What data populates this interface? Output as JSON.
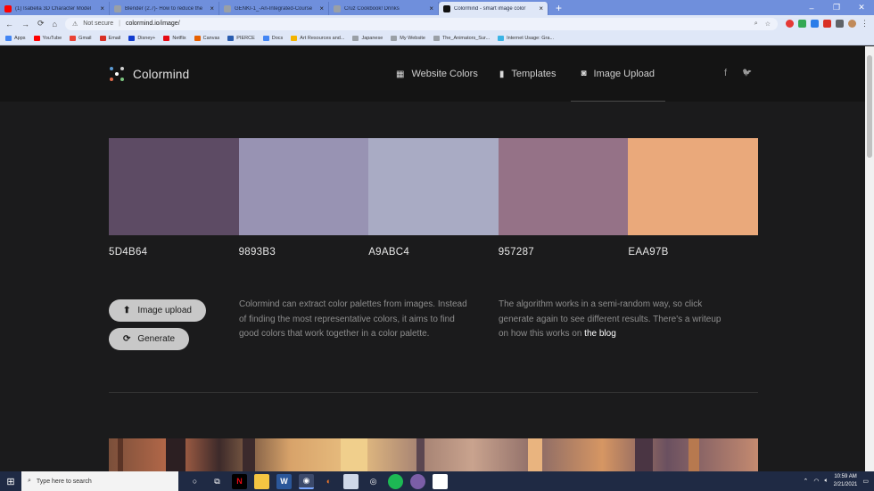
{
  "browser": {
    "tabs": [
      {
        "title": "(1) Isabella 3D Character Model",
        "favicon_color": "#ff0000",
        "active": false
      },
      {
        "title": "Blender (2.7)- How to reduce the",
        "favicon_color": "#9aa0a6",
        "active": false
      },
      {
        "title": "GENKI-1_-An-Integrated-Course",
        "favicon_color": "#9aa0a6",
        "active": false
      },
      {
        "title": "Cruz Cookbook! Drinks",
        "favicon_color": "#9aa0a6",
        "active": false
      },
      {
        "title": "Colormind - smart image color",
        "favicon_color": "#111111",
        "active": true
      }
    ],
    "new_tab": "+",
    "window_controls": [
      "–",
      "❐",
      "✕"
    ],
    "security_label": "Not secure",
    "url": "colormind.io/image/",
    "bookmarks": [
      {
        "label": "Apps",
        "color": "#4285f4"
      },
      {
        "label": "YouTube",
        "color": "#ff0000"
      },
      {
        "label": "Gmail",
        "color": "#ea4335"
      },
      {
        "label": "Email",
        "color": "#d93025"
      },
      {
        "label": "Disney+",
        "color": "#113ccf"
      },
      {
        "label": "Netflix",
        "color": "#e50914"
      },
      {
        "label": "Canvas",
        "color": "#e66000"
      },
      {
        "label": "PIERCE",
        "color": "#2a5db0"
      },
      {
        "label": "Docs",
        "color": "#4285f4"
      },
      {
        "label": "Art Resources and...",
        "color": "#f4b400"
      },
      {
        "label": "Japanese",
        "color": "#9aa0a6"
      },
      {
        "label": "My Website",
        "color": "#9aa0a6"
      },
      {
        "label": "The_Animators_Sur...",
        "color": "#9aa0a6"
      },
      {
        "label": "Internet Usage: Gra...",
        "color": "#3bb4e5"
      }
    ]
  },
  "site": {
    "brand": "Colormind",
    "nav": [
      {
        "label": "Website Colors",
        "icon": "grid-icon",
        "active": false
      },
      {
        "label": "Templates",
        "icon": "bookmark-icon",
        "active": false
      },
      {
        "label": "Image Upload",
        "icon": "camera-icon",
        "active": true
      }
    ],
    "social": [
      "f",
      "🐦"
    ],
    "palette": [
      {
        "hex": "5D4B64",
        "color": "#5D4B64"
      },
      {
        "hex": "9893B3",
        "color": "#9893B3"
      },
      {
        "hex": "A9ABC4",
        "color": "#A9ABC4"
      },
      {
        "hex": "957287",
        "color": "#957287"
      },
      {
        "hex": "EAA97B",
        "color": "#EAA97B"
      }
    ],
    "buttons": {
      "upload": "Image upload",
      "generate": "Generate"
    },
    "description_1": "Colormind can extract color palettes from images. Instead of finding the most representative colors, it aims to find good colors that work together in a color palette.",
    "description_2_prefix": "The algorithm works in a semi-random way, so click generate again to see different results. There's a writeup on how this works on ",
    "description_2_link": "the blog"
  },
  "taskbar": {
    "search_placeholder": "Type here to search",
    "time": "10:59 AM",
    "date": "2/21/2021"
  }
}
